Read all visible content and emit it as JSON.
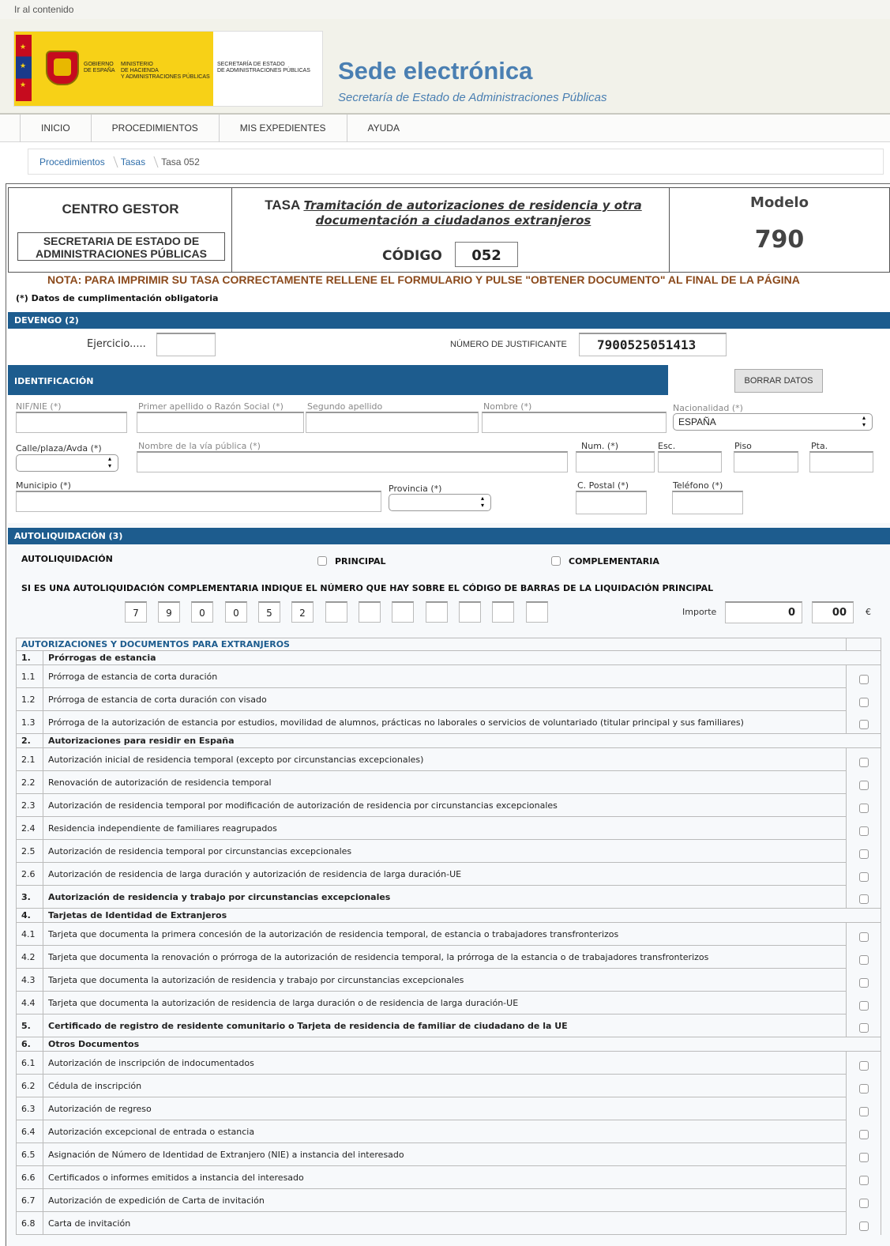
{
  "skip_link": "Ir al contenido",
  "header": {
    "gov_line1": "GOBIERNO\nDE ESPAÑA",
    "gov_line2": "MINISTERIO\nDE HACIENDA\nY ADMINISTRACIONES PÚBLICAS",
    "secretaria": "SECRETARÍA DE ESTADO\nDE ADMINISTRACIONES PÚBLICAS",
    "title": "Sede electrónica",
    "subtitle": "Secretaría de Estado de Administraciones Públicas"
  },
  "nav": [
    "INICIO",
    "PROCEDIMIENTOS",
    "MIS EXPEDIENTES",
    "AYUDA"
  ],
  "breadcrumb": {
    "items": [
      "Procedimientos",
      "Tasas"
    ],
    "current": "Tasa 052"
  },
  "form": {
    "centro_gestor": "CENTRO GESTOR",
    "centro_nombre": "SECRETARIA DE ESTADO DE ADMINISTRACIONES PÚBLICAS",
    "tasa_label": "TASA",
    "tasa_title": "Tramitación de autorizaciones de residencia y otra documentación a ciudadanos extranjeros",
    "codigo_label": "CÓDIGO",
    "codigo": "052",
    "modelo_label": "Modelo",
    "modelo": "790",
    "nota": "NOTA: PARA IMPRIMIR SU TASA CORRECTAMENTE RELLENE EL FORMULARIO Y PULSE \"OBTENER DOCUMENTO\" AL FINAL DE LA PÁGINA",
    "obligatorios": "(*) Datos de cumplimentación obligatoria"
  },
  "devengo": {
    "title": "DEVENGO (2)",
    "ejercicio_label": "Ejercicio.....",
    "ejercicio_value": "",
    "justificante_label": "NÚMERO DE JUSTIFICANTE",
    "justificante_value": "7900525051413"
  },
  "identificacion": {
    "title": "IDENTIFICACIÓN",
    "borrar": "BORRAR DATOS",
    "nif": "NIF/NIE (*)",
    "apellido1": "Primer apellido o Razón Social (*)",
    "apellido2": "Segundo apellido",
    "nombre": "Nombre (*)",
    "nacionalidad": "Nacionalidad (*)",
    "nacionalidad_value": "ESPAÑA",
    "calle": "Calle/plaza/Avda (*)",
    "via": "Nombre de la vía pública (*)",
    "num": "Num. (*)",
    "esc": "Esc.",
    "piso": "Piso",
    "pta": "Pta.",
    "municipio": "Municipio (*)",
    "provincia": "Provincia (*)",
    "cpostal": "C. Postal (*)",
    "telefono": "Teléfono (*)"
  },
  "autoliquidacion": {
    "title": "AUTOLIQUIDACIÓN (3)",
    "label": "AUTOLIQUIDACIÓN",
    "principal": "PRINCIPAL",
    "complementaria": "COMPLEMENTARIA",
    "instruccion": "SI ES UNA AUTOLIQUIDACIÓN COMPLEMENTARIA INDIQUE EL NÚMERO QUE HAY SOBRE EL CÓDIGO DE BARRAS DE LA LIQUIDACIÓN PRINCIPAL",
    "digits": [
      "7",
      "9",
      "0",
      "0",
      "5",
      "2",
      "",
      "",
      "",
      "",
      "",
      "",
      ""
    ],
    "importe_label": "Importe",
    "importe_entero": "0",
    "importe_decimal": "00",
    "currency": "€"
  },
  "conceptos": {
    "header": "AUTORIZACIONES Y DOCUMENTOS PARA EXTRANJEROS",
    "rows": [
      {
        "num": "1.",
        "text": "Prórrogas de estancia",
        "type": "group"
      },
      {
        "num": "1.1",
        "text": "Prórroga de estancia de corta duración",
        "type": "item"
      },
      {
        "num": "1.2",
        "text": "Prórroga de estancia de corta duración con visado",
        "type": "item"
      },
      {
        "num": "1.3",
        "text": "Prórroga de la autorización de estancia por estudios, movilidad de alumnos, prácticas no laborales o servicios de voluntariado (titular principal y sus familiares)",
        "type": "item"
      },
      {
        "num": "2.",
        "text": "Autorizaciones para residir en España",
        "type": "group"
      },
      {
        "num": "2.1",
        "text": "Autorización inicial de residencia temporal (excepto por circunstancias excepcionales)",
        "type": "item"
      },
      {
        "num": "2.2",
        "text": "Renovación de autorización de residencia temporal",
        "type": "item"
      },
      {
        "num": "2.3",
        "text": "Autorización de residencia temporal por modificación de autorización de residencia por circunstancias excepcionales",
        "type": "item"
      },
      {
        "num": "2.4",
        "text": "Residencia independiente de familiares reagrupados",
        "type": "item"
      },
      {
        "num": "2.5",
        "text": "Autorización de residencia temporal por circunstancias excepcionales",
        "type": "item"
      },
      {
        "num": "2.6",
        "text": "Autorización de residencia de larga duración y autorización de residencia de larga duración-UE",
        "type": "item"
      },
      {
        "num": "3.",
        "text": "Autorización de residencia y trabajo por circunstancias excepcionales",
        "type": "groupcheck"
      },
      {
        "num": "4.",
        "text": "Tarjetas de Identidad de Extranjeros",
        "type": "group"
      },
      {
        "num": "4.1",
        "text": "Tarjeta que documenta la primera concesión de la autorización de residencia temporal, de estancia o trabajadores transfronterizos",
        "type": "item"
      },
      {
        "num": "4.2",
        "text": "Tarjeta que documenta la renovación o prórroga de la autorización de residencia temporal, la prórroga de la estancia o de trabajadores transfronterizos",
        "type": "item"
      },
      {
        "num": "4.3",
        "text": "Tarjeta que documenta la autorización de residencia y trabajo por circunstancias excepcionales",
        "type": "item"
      },
      {
        "num": "4.4",
        "text": "Tarjeta que documenta la autorización de residencia de larga duración o de residencia de larga duración-UE",
        "type": "item"
      },
      {
        "num": "5.",
        "text": "Certificado de registro de residente comunitario o Tarjeta de residencia de familiar de ciudadano de la UE",
        "type": "groupcheck"
      },
      {
        "num": "6.",
        "text": "Otros Documentos",
        "type": "group"
      },
      {
        "num": "6.1",
        "text": "Autorización de inscripción de indocumentados",
        "type": "item"
      },
      {
        "num": "6.2",
        "text": "Cédula de inscripción",
        "type": "item"
      },
      {
        "num": "6.3",
        "text": "Autorización de regreso",
        "type": "item"
      },
      {
        "num": "6.4",
        "text": "Autorización excepcional de entrada o estancia",
        "type": "item"
      },
      {
        "num": "6.5",
        "text": "Asignación de Número de Identidad de Extranjero (NIE) a instancia del interesado",
        "type": "item"
      },
      {
        "num": "6.6",
        "text": "Certificados o informes emitidos a instancia del interesado",
        "type": "item"
      },
      {
        "num": "6.7",
        "text": "Autorización de expedición de Carta de invitación",
        "type": "item"
      },
      {
        "num": "6.8",
        "text": "Carta de invitación",
        "type": "item"
      }
    ]
  }
}
